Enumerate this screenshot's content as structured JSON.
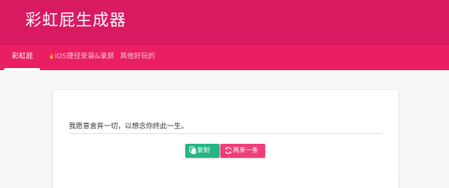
{
  "app": {
    "title": "彩虹屁生成器"
  },
  "colors": {
    "header": "#d81b60",
    "tabbar": "#e91e63",
    "copy_button": "#26b585",
    "again_button": "#ee3f7a"
  },
  "tabs": [
    {
      "label": "彩虹屁",
      "active": true
    },
    {
      "label": "iOS捷径安装&录屏",
      "icon": "flame-icon",
      "active": false
    },
    {
      "label": "其他好玩的",
      "active": false
    }
  ],
  "main": {
    "quote": "我愿意舍弃一切，以想念你终此一生。",
    "copy_label": "复制",
    "copy_icon": "copy-icon",
    "again_label": "再来一条",
    "again_icon": "refresh-icon"
  }
}
